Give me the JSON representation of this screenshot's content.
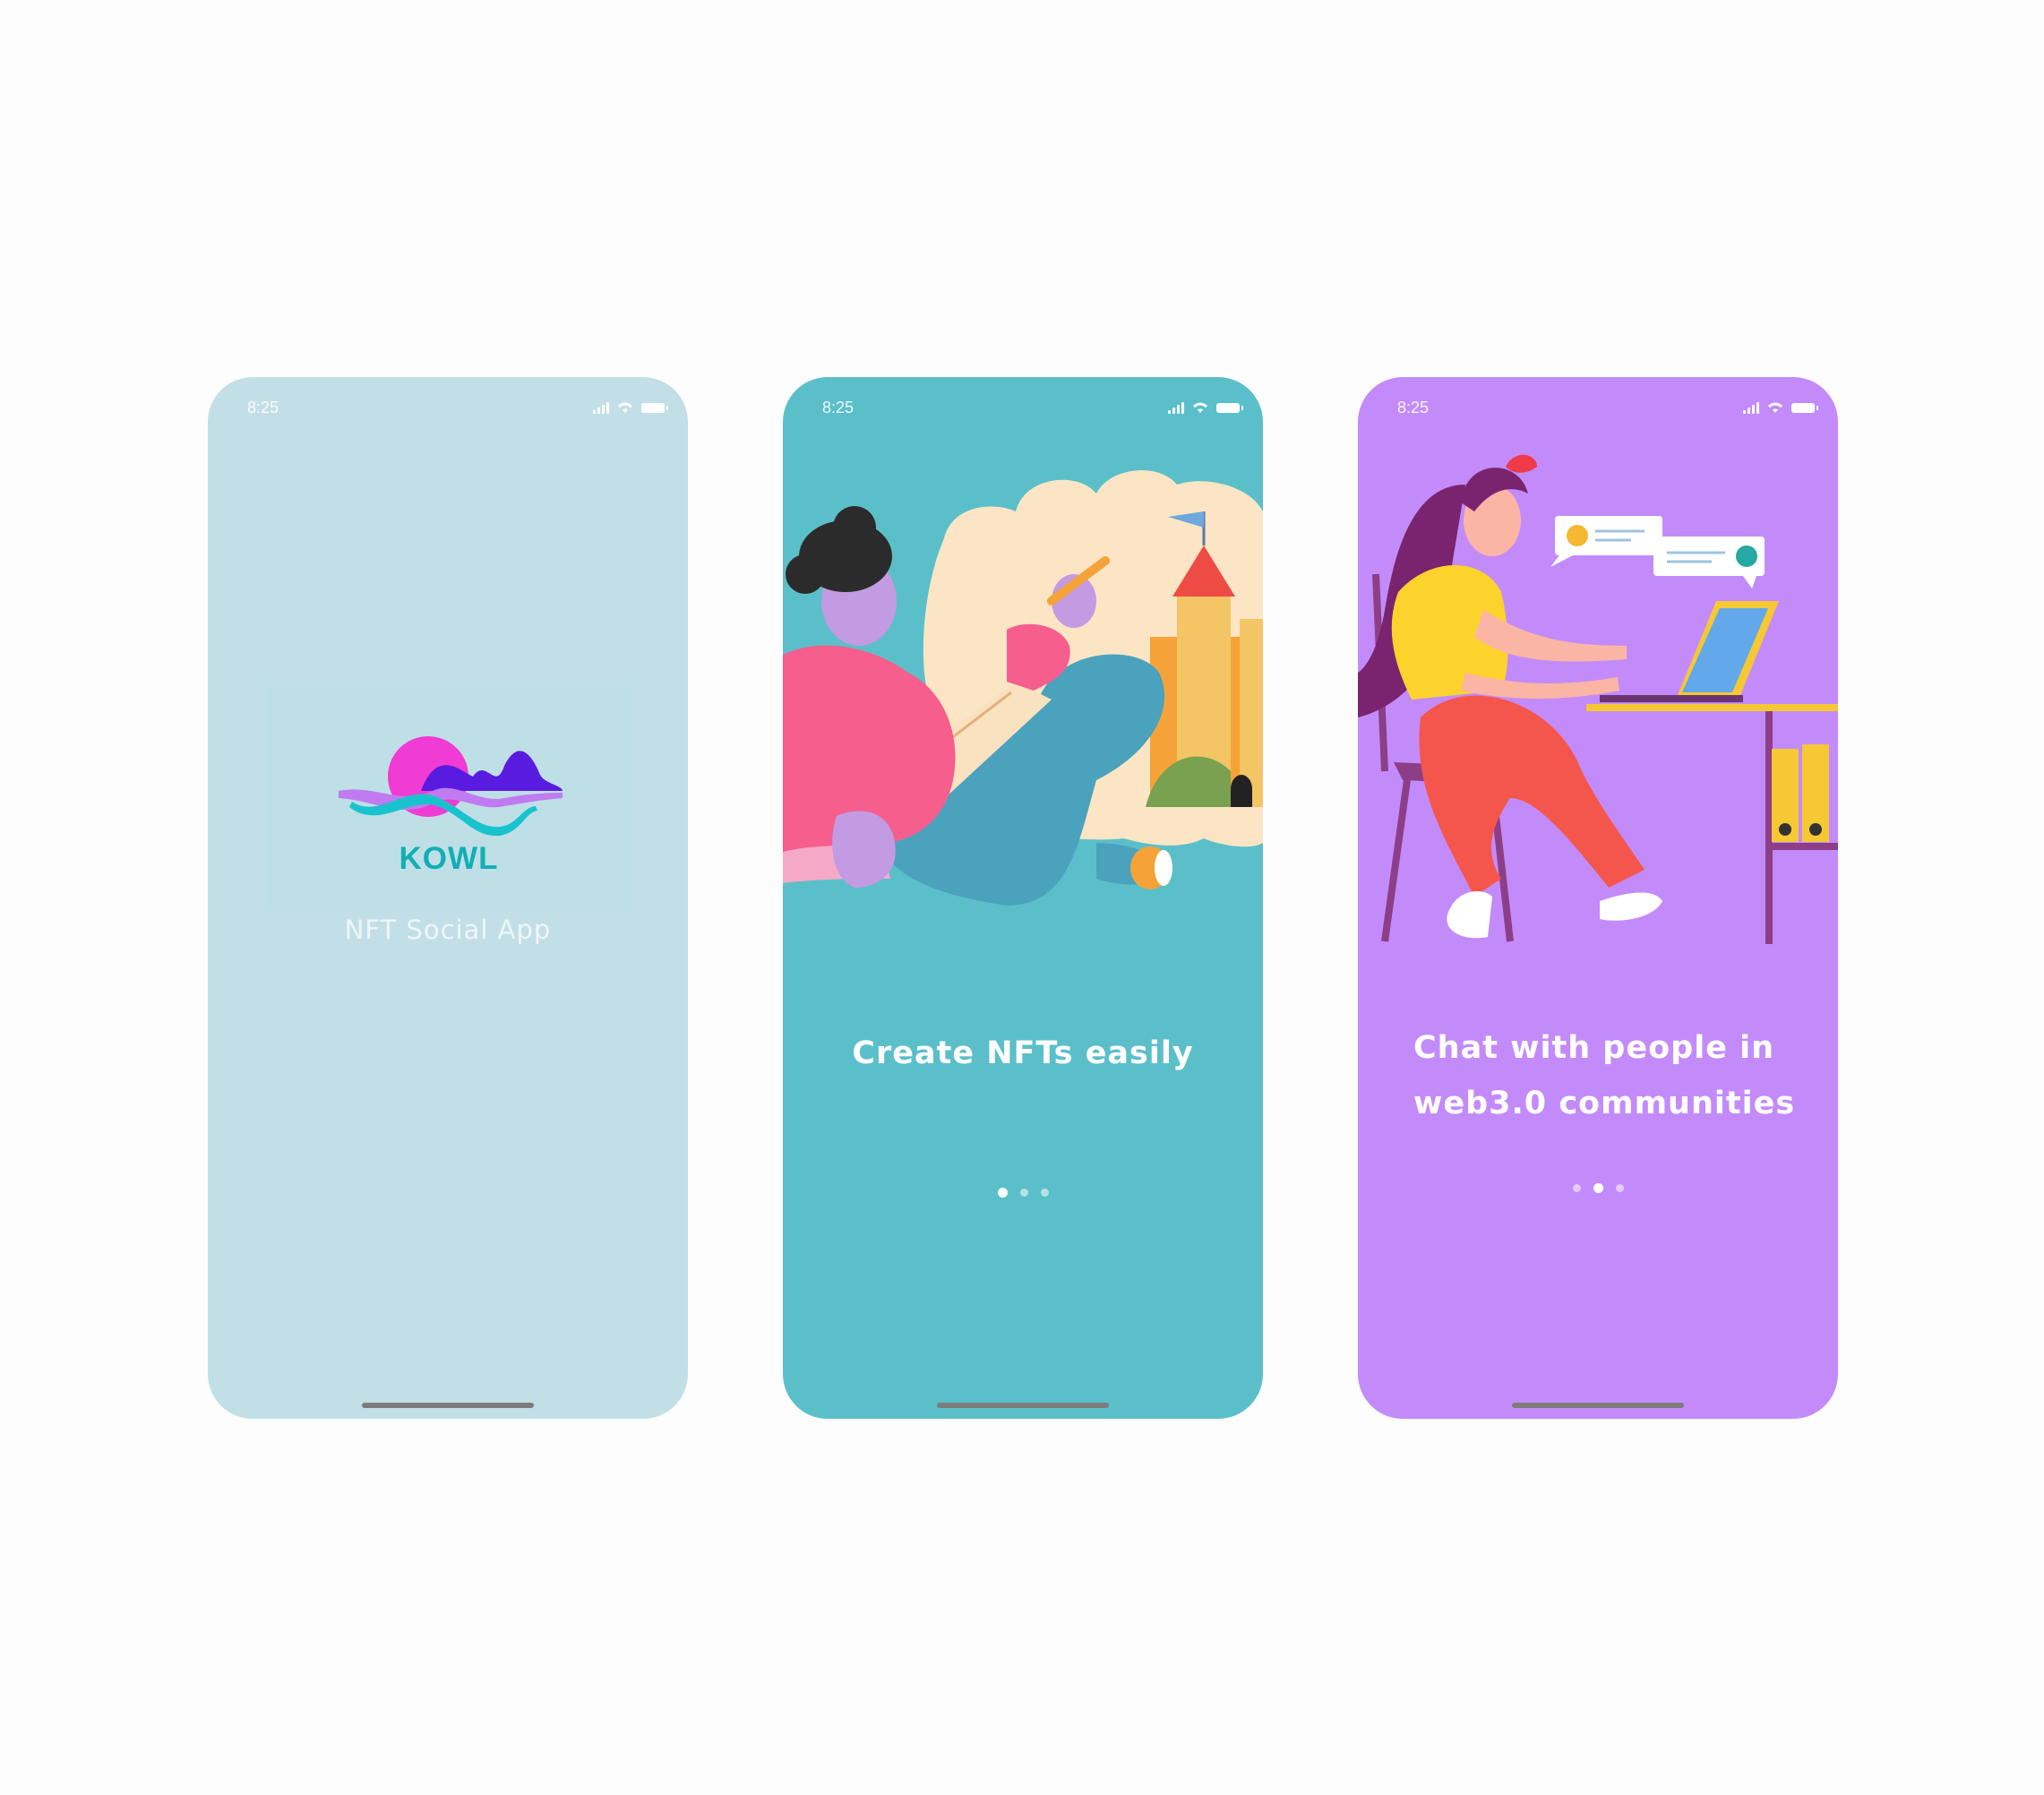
{
  "screens": [
    {
      "id": "splash",
      "background": "#c2dfe7",
      "status_time": "8:25",
      "logo_text": "KOWL",
      "tagline": "NFT Social App",
      "logo_colors": [
        "#f03bd4",
        "#5a1be0",
        "#19c3cd"
      ]
    },
    {
      "id": "onboarding-create",
      "background": "#5bbfca",
      "status_time": "8:25",
      "caption": "Create NFTs easily",
      "active_dot": 1,
      "total_dots": 3
    },
    {
      "id": "onboarding-chat",
      "background": "#c38bfa",
      "status_time": "8:25",
      "caption_line1": "Chat with people in",
      "caption_line2": "web3.0 communities",
      "active_dot": 2,
      "total_dots": 3
    }
  ],
  "icons": [
    "signal-icon",
    "wifi-icon",
    "battery-icon"
  ]
}
